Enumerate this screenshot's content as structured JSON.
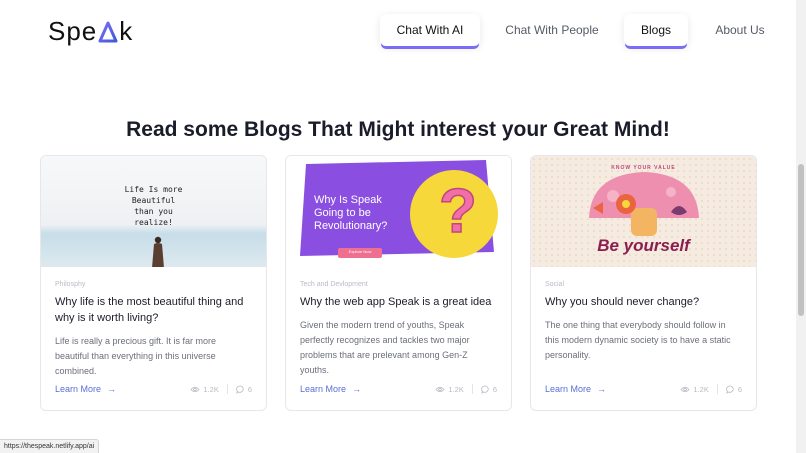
{
  "brand": {
    "logo_left": "Spe",
    "logo_right": "k"
  },
  "nav": {
    "items": [
      {
        "label": "Chat With AI"
      },
      {
        "label": "Chat With People"
      },
      {
        "label": "Blogs"
      },
      {
        "label": "About Us"
      }
    ]
  },
  "main": {
    "headline": "Read some Blogs That Might interest your Great Mind!",
    "cards": [
      {
        "image_text": [
          "Life Is more",
          "Beautiful",
          "than you",
          "realize!"
        ],
        "category": "Philosphy",
        "title": "Why life is the most beautiful thing and why is it worth living?",
        "description": "Life is really a precious gift. It is far more beautiful than everything in this universe combined.",
        "link": "Learn More",
        "views": "1.2K",
        "comments": "6"
      },
      {
        "image_text": [
          "Why Is Speak",
          "Going to be",
          "Revolutionary?"
        ],
        "image_button": "Explore Now",
        "image_symbol": "?",
        "category": "Tech and Devlopment",
        "title": "Why the web app Speak is a great idea",
        "description": "Given the modern trend of youths, Speak perfectly recognizes and tackles two major problems that are prelevant among Gen-Z youths.",
        "link": "Learn More",
        "views": "1.2K",
        "comments": "6"
      },
      {
        "image_top": "KNOW YOUR VALUE",
        "image_text": "Be yourself",
        "category": "Social",
        "title": "Why you should never change?",
        "description": "The one thing that everybody should follow in this modern dynamic society is to have a static personality.",
        "link": "Learn More",
        "views": "1.2K",
        "comments": "6"
      }
    ]
  },
  "status_bar": {
    "url": "https://thespeak.netlify.app/ai"
  },
  "colors": {
    "accent": "#7b6cf6",
    "link": "#5b6ed6",
    "purple": "#8a4fe0",
    "yellow": "#f7d83a",
    "pink": "#ee6f8f"
  }
}
